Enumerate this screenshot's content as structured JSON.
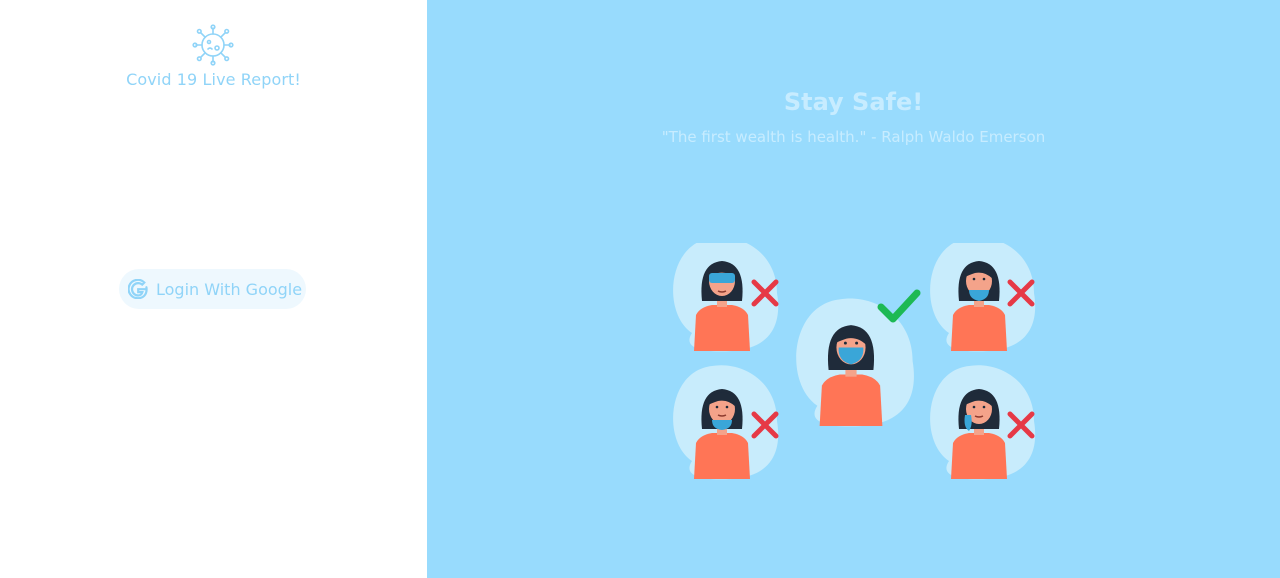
{
  "app": {
    "title": "Covid 19 Live Report!",
    "logo_icon": "virus-icon"
  },
  "login": {
    "button_label": "Login With Google",
    "icon": "google-icon"
  },
  "hero": {
    "heading": "Stay Safe!",
    "quote": "\"The first wealth is health.\" - Ralph Waldo Emerson",
    "illustration": "mask-wearing-guide-illustration"
  },
  "colors": {
    "left_background": "#ffffff",
    "right_background": "#98dbfd",
    "accent": "#90d4f8",
    "hero_text": "#c7ecff",
    "wrong_mark": "#e63946",
    "correct_mark": "#1db954",
    "mask": "#3aa6d8",
    "shirt": "#ff7556",
    "hair": "#1f2b3a",
    "skin": "#f4a38a"
  }
}
